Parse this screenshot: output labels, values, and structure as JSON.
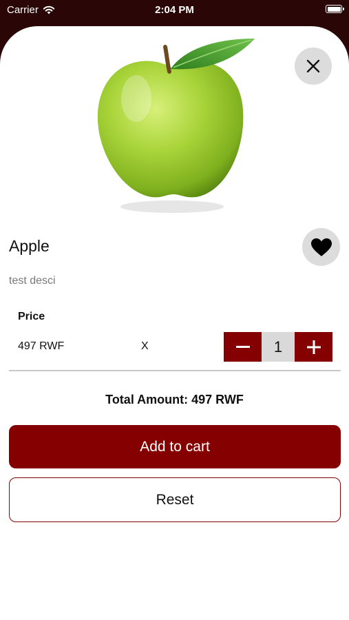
{
  "status_bar": {
    "carrier": "Carrier",
    "time": "2:04 PM"
  },
  "product": {
    "name": "Apple",
    "description": "test desci",
    "price_label": "Price",
    "price": "497 RWF",
    "multiply_sign": "X",
    "quantity": "1",
    "total": "Total Amount: 497 RWF",
    "image_icon": "green-apple-image"
  },
  "actions": {
    "add_to_cart": "Add to cart",
    "reset": "Reset"
  },
  "icons": {
    "close": "close-icon",
    "favorite": "heart-icon",
    "minus": "minus-icon",
    "plus": "plus-icon"
  },
  "colors": {
    "accent": "#850000",
    "header_bg": "#2a0606",
    "button_gray": "#dcdcdc"
  }
}
